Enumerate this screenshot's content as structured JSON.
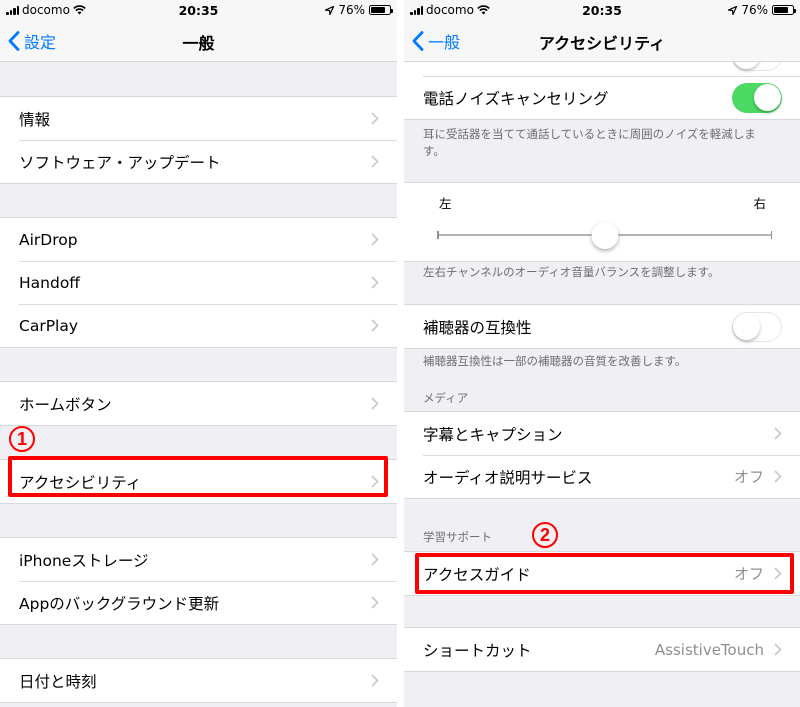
{
  "statusbar": {
    "carrier": "docomo",
    "time": "20:35",
    "battery": "76%",
    "battery_level": 0.76
  },
  "left": {
    "nav": {
      "back_label": "設定",
      "title": "一般"
    },
    "groups": [
      {
        "items": [
          {
            "label": "情報"
          },
          {
            "label": "ソフトウェア・アップデート"
          }
        ]
      },
      {
        "items": [
          {
            "label": "AirDrop"
          },
          {
            "label": "Handoff"
          },
          {
            "label": "CarPlay"
          }
        ]
      },
      {
        "items": [
          {
            "label": "ホームボタン"
          }
        ]
      },
      {
        "items": [
          {
            "label": "アクセシビリティ"
          }
        ]
      },
      {
        "items": [
          {
            "label": "iPhoneストレージ"
          },
          {
            "label": "Appのバックグラウンド更新"
          }
        ]
      },
      {
        "items": [
          {
            "label": "日付と時刻"
          }
        ]
      }
    ],
    "step_badge": "1"
  },
  "right": {
    "nav": {
      "back_label": "一般",
      "title": "アクセシビリティ"
    },
    "noise_cancel": {
      "label": "電話ノイズキャンセリング",
      "on": true,
      "footer": "耳に受話器を当てて通話しているときに周囲のノイズを軽減します。"
    },
    "balance": {
      "left_label": "左",
      "right_label": "右",
      "value": 0.5,
      "footer": "左右チャンネルのオーディオ音量バランスを調整します。"
    },
    "hearing_aid": {
      "label": "補聴器の互換性",
      "on": false,
      "footer": "補聴器互換性は一部の補聴器の音質を改善します。"
    },
    "media": {
      "header": "メディア",
      "items": [
        {
          "label": "字幕とキャプション",
          "value": ""
        },
        {
          "label": "オーディオ説明サービス",
          "value": "オフ"
        }
      ]
    },
    "learning": {
      "header": "学習サポート",
      "items": [
        {
          "label": "アクセスガイド",
          "value": "オフ"
        }
      ]
    },
    "shortcut": {
      "label": "ショートカット",
      "value": "AssistiveTouch"
    },
    "step_badge": "2"
  },
  "colors": {
    "accent": "#007aff",
    "toggle_on": "#4cd964",
    "highlight": "#ff0000",
    "background": "#efeff4"
  }
}
